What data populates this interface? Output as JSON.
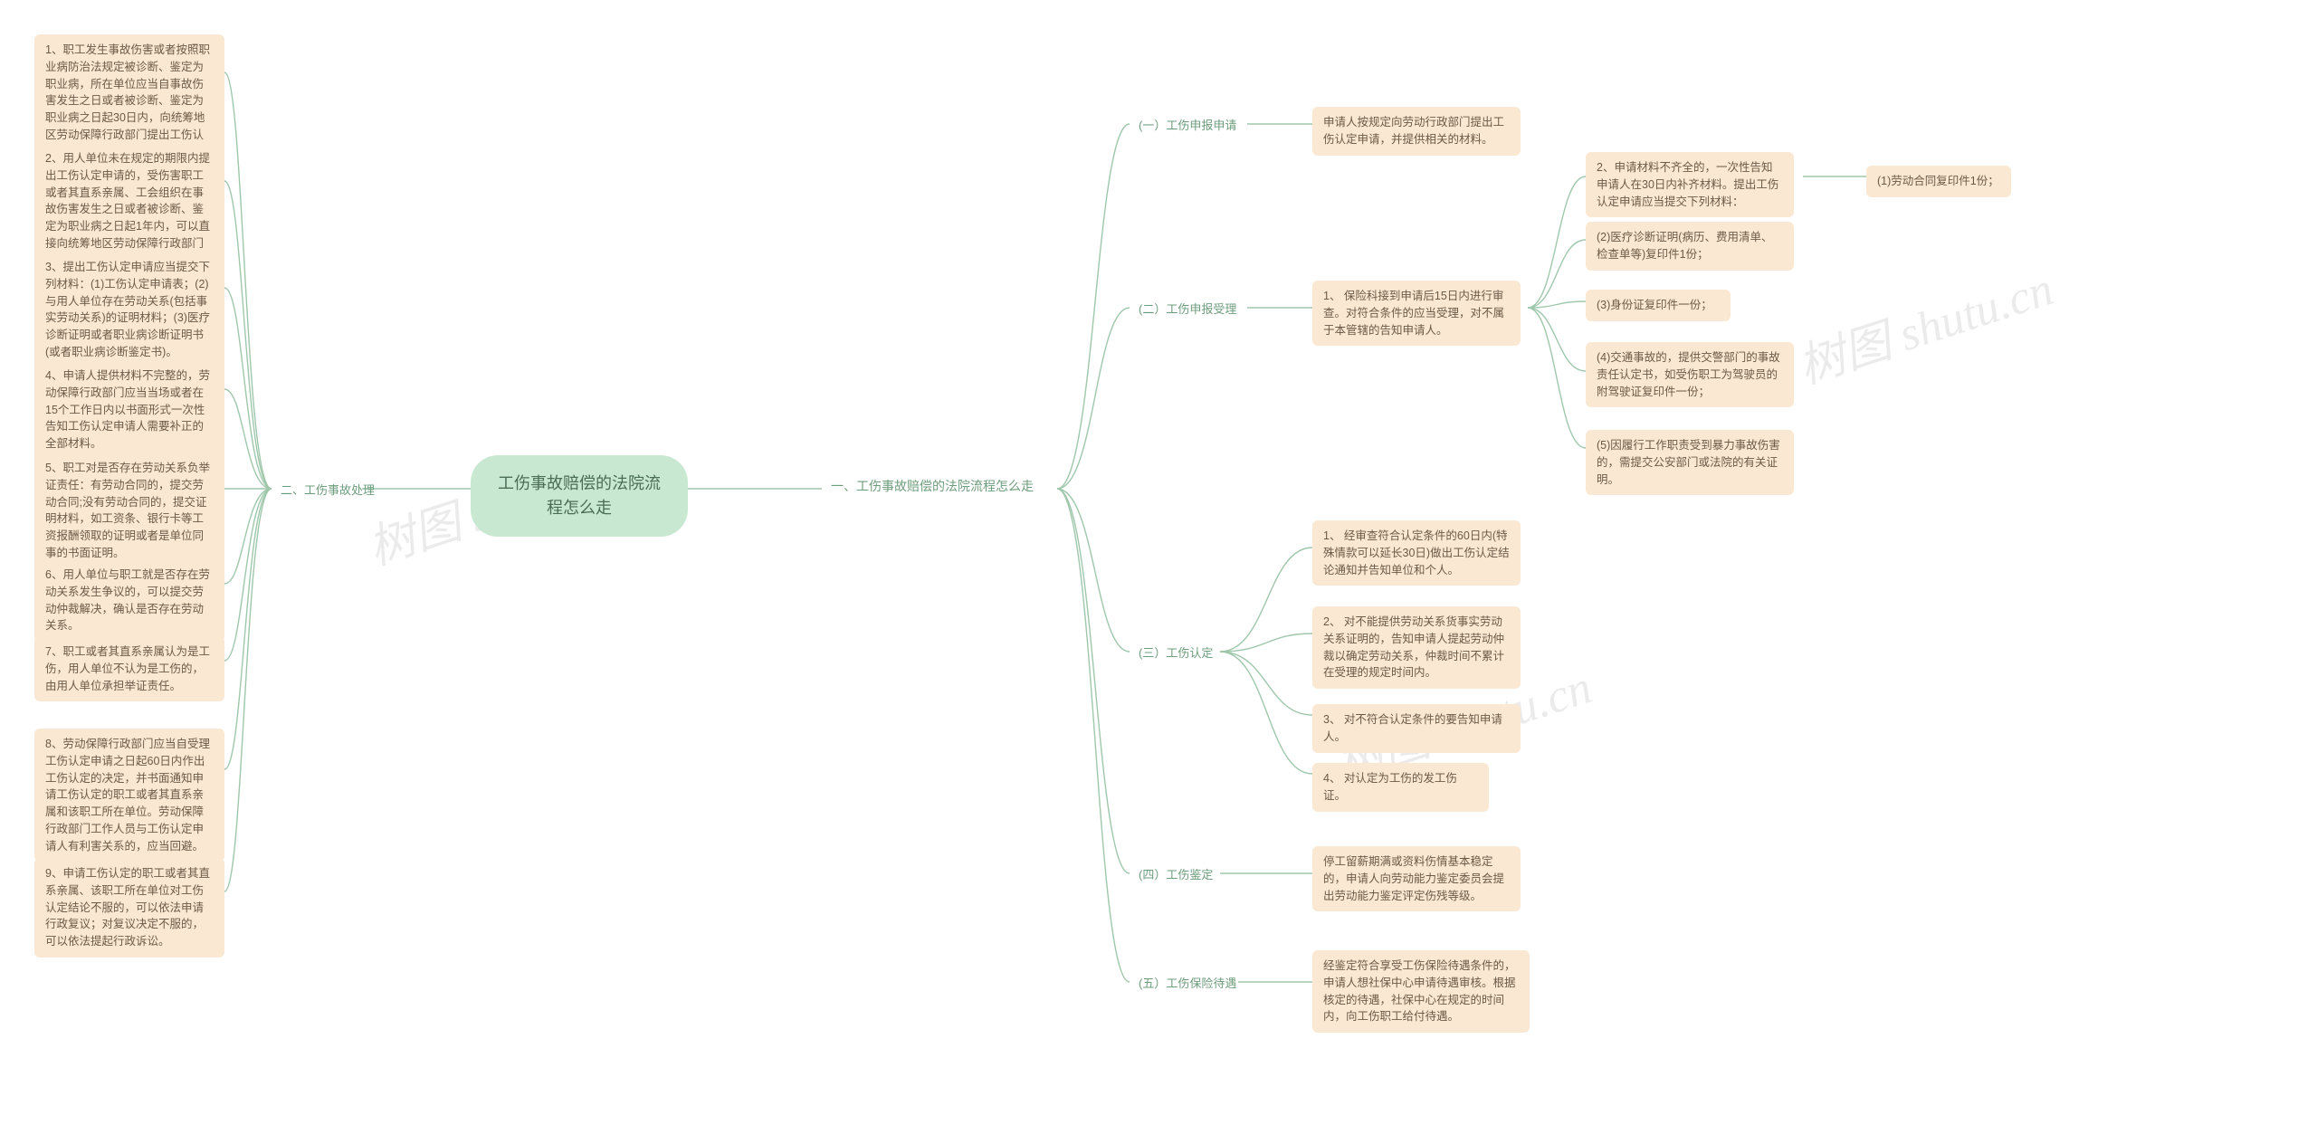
{
  "watermark": "树图 shutu.cn",
  "root": "工伤事故赔偿的法院流程怎么走",
  "right": {
    "branch1": "一、工伤事故赔偿的法院流程怎么走",
    "s1": {
      "title": "(一）工伤申报申请",
      "leaf": "申请人按规定向劳动行政部门提出工伤认定申请，并提供相关的材料。"
    },
    "s2": {
      "title": "(二）工伤申报受理",
      "leaf1": "1、 保险科接到申请后15日内进行审查。对符合条件的应当受理，对不属于本管辖的告知申请人。",
      "leaf2": "2、申请材料不齐全的，一次性告知申请人在30日内补齐材料。提出工伤认定申请应当提交下列材料：",
      "sub": {
        "a": "(1)劳动合同复印件1份；",
        "b": "(2)医疗诊断证明(病历、费用清单、检查单等)复印件1份；",
        "c": "(3)身份证复印件一份；",
        "d": "(4)交通事故的，提供交警部门的事故责任认定书，如受伤职工为驾驶员的附驾驶证复印件一份；",
        "e": "(5)因履行工作职责受到暴力事故伤害的，需提交公安部门或法院的有关证明。"
      }
    },
    "s3": {
      "title": "(三）工伤认定",
      "a": "1、 经审查符合认定条件的60日内(特殊情款可以延长30日)做出工伤认定结论通知并告知单位和个人。",
      "b": "2、 对不能提供劳动关系货事实劳动关系证明的，告知申请人提起劳动仲裁以确定劳动关系，仲裁时间不累计在受理的规定时间内。",
      "c": "3、 对不符合认定条件的要告知申请人。",
      "d": "4、 对认定为工伤的发工伤证。"
    },
    "s4": {
      "title": "(四）工伤鉴定",
      "leaf": "停工留薪期满或资料伤情基本稳定的，申请人向劳动能力鉴定委员会提出劳动能力鉴定评定伤残等级。"
    },
    "s5": {
      "title": "(五）工伤保险待遇",
      "leaf": "经鉴定符合享受工伤保险待遇条件的，申请人想社保中心申请待遇审核。根据核定的待遇，社保中心在规定的时间内，向工伤职工给付待遇。"
    }
  },
  "left": {
    "branch2": "二、工伤事故处理",
    "items": [
      "1、职工发生事故伤害或者按照职业病防治法规定被诊断、鉴定为职业病，所在单位应当自事故伤害发生之日或者被诊断、鉴定为职业病之日起30日内，向统筹地区劳动保障行政部门提出工伤认定申请。",
      "2、用人单位未在规定的期限内提出工伤认定申请的，受伤害职工或者其直系亲属、工会组织在事故伤害发生之日或者被诊断、鉴定为职业病之日起1年内，可以直接向统筹地区劳动保障行政部门提出工伤认定申请。",
      "3、提出工伤认定申请应当提交下列材料：(1)工伤认定申请表；(2)与用人单位存在劳动关系(包括事实劳动关系)的证明材料；(3)医疗诊断证明或者职业病诊断证明书(或者职业病诊断鉴定书)。",
      "4、申请人提供材料不完整的，劳动保障行政部门应当当场或者在15个工作日内以书面形式一次性告知工伤认定申请人需要补正的全部材料。",
      "5、职工对是否存在劳动关系负举证责任：有劳动合同的，提交劳动合同;没有劳动合同的，提交证明材料，如工资条、银行卡等工资报酬领取的证明或者是单位同事的书面证明。",
      "6、用人单位与职工就是否存在劳动关系发生争议的，可以提交劳动仲裁解决，确认是否存在劳动关系。",
      "7、职工或者其直系亲属认为是工伤，用人单位不认为是工伤的，由用人单位承担举证责任。",
      "8、劳动保障行政部门应当自受理工伤认定申请之日起60日内作出工伤认定的决定，并书面通知申请工伤认定的职工或者其直系亲属和该职工所在单位。劳动保障行政部门工作人员与工伤认定申请人有利害关系的，应当回避。",
      "9、申请工伤认定的职工或者其直系亲属、该职工所在单位对工伤认定结论不服的，可以依法申请行政复议；对复议决定不服的，可以依法提起行政诉讼。"
    ]
  }
}
